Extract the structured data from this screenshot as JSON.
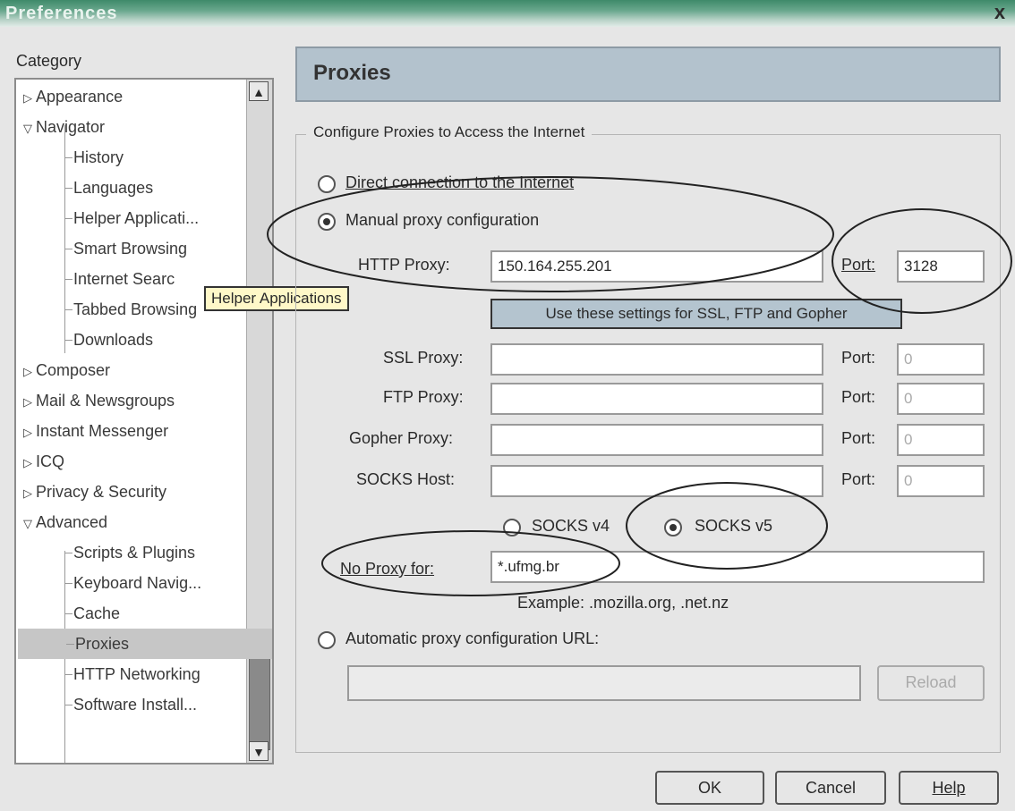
{
  "window": {
    "title": "Preferences",
    "close_label": "x"
  },
  "sidebar": {
    "category_label": "Category",
    "items": [
      {
        "label": "Appearance",
        "type": "top",
        "expander": "▷"
      },
      {
        "label": "Navigator",
        "type": "top",
        "expander": "▽"
      },
      {
        "label": "History",
        "type": "child"
      },
      {
        "label": "Languages",
        "type": "child"
      },
      {
        "label": "Helper Applicati...",
        "type": "child"
      },
      {
        "label": "Smart Browsing",
        "type": "child"
      },
      {
        "label": "Internet Searc",
        "type": "child"
      },
      {
        "label": "Tabbed Browsing",
        "type": "child"
      },
      {
        "label": "Downloads",
        "type": "child"
      },
      {
        "label": "Composer",
        "type": "top",
        "expander": "▷"
      },
      {
        "label": "Mail & Newsgroups",
        "type": "top",
        "expander": "▷"
      },
      {
        "label": "Instant Messenger",
        "type": "top",
        "expander": "▷"
      },
      {
        "label": "ICQ",
        "type": "top",
        "expander": "▷"
      },
      {
        "label": "Privacy & Security",
        "type": "top",
        "expander": "▷"
      },
      {
        "label": "Advanced",
        "type": "top",
        "expander": "▽"
      },
      {
        "label": "Scripts & Plugins",
        "type": "child"
      },
      {
        "label": "Keyboard Navig...",
        "type": "child"
      },
      {
        "label": "Cache",
        "type": "child"
      },
      {
        "label": "Proxies",
        "type": "child",
        "selected": true
      },
      {
        "label": "HTTP Networking",
        "type": "child"
      },
      {
        "label": "Software Install...",
        "type": "child"
      }
    ],
    "tooltip": "Helper Applications"
  },
  "main": {
    "header": "Proxies",
    "group_title": "Configure Proxies to Access the Internet",
    "direct_label": "Direct connection to the Internet",
    "manual_label": "Manual proxy configuration",
    "http_label": "HTTP Proxy:",
    "http_value": "150.164.255.201",
    "http_port_label": "Port:",
    "http_port_value": "3128",
    "use_settings_label": "Use these settings for SSL, FTP and Gopher",
    "ssl_label": "SSL Proxy:",
    "ssl_value": "",
    "ssl_port_label": "Port:",
    "ssl_port_value": "0",
    "ftp_label": "FTP Proxy:",
    "ftp_value": "",
    "ftp_port_label": "Port:",
    "ftp_port_value": "0",
    "gopher_label": "Gopher Proxy:",
    "gopher_value": "",
    "gopher_port_label": "Port:",
    "gopher_port_value": "0",
    "socks_label": "SOCKS Host:",
    "socks_value": "",
    "socks_port_label": "Port:",
    "socks_port_value": "0",
    "socks_v4_label": "SOCKS v4",
    "socks_v5_label": "SOCKS v5",
    "no_proxy_label": "No Proxy for:",
    "no_proxy_value": "*.ufmg.br",
    "example_text": "Example: .mozilla.org, .net.nz",
    "auto_label": "Automatic proxy configuration URL:",
    "auto_value": "",
    "reload_label": "Reload"
  },
  "footer": {
    "ok_label": "OK",
    "cancel_label": "Cancel",
    "help_label": "Help"
  },
  "colors": {
    "titlebar": "#3e8a6a",
    "header_bg": "#b3c2cd",
    "selected_bg": "#c6c6c6",
    "tooltip_bg": "#fff8c8"
  }
}
